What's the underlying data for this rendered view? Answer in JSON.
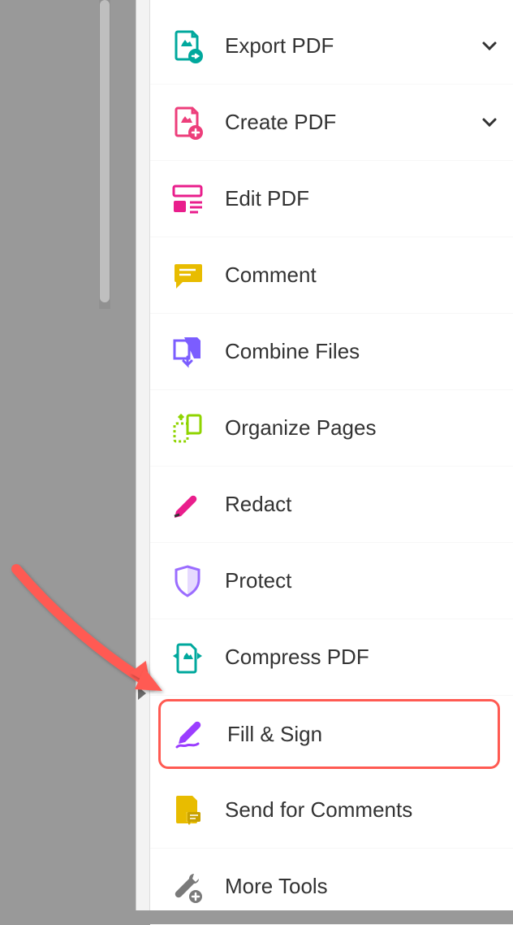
{
  "tools": [
    {
      "id": "export-pdf",
      "label": "Export PDF",
      "expandable": true,
      "icon": "export-pdf-icon",
      "color": "#00a89d"
    },
    {
      "id": "create-pdf",
      "label": "Create PDF",
      "expandable": true,
      "icon": "create-pdf-icon",
      "color": "#ed3e7b"
    },
    {
      "id": "edit-pdf",
      "label": "Edit PDF",
      "expandable": false,
      "icon": "edit-pdf-icon",
      "color": "#e91e8c"
    },
    {
      "id": "comment",
      "label": "Comment",
      "expandable": false,
      "icon": "comment-icon",
      "color": "#e8bc00"
    },
    {
      "id": "combine-files",
      "label": "Combine Files",
      "expandable": false,
      "icon": "combine-files-icon",
      "color": "#7b5dff"
    },
    {
      "id": "organize-pages",
      "label": "Organize Pages",
      "expandable": false,
      "icon": "organize-pages-icon",
      "color": "#8fd400"
    },
    {
      "id": "redact",
      "label": "Redact",
      "expandable": false,
      "icon": "redact-icon",
      "color": "#e91e8c"
    },
    {
      "id": "protect",
      "label": "Protect",
      "expandable": false,
      "icon": "protect-icon",
      "color": "#9b6dff"
    },
    {
      "id": "compress-pdf",
      "label": "Compress PDF",
      "expandable": false,
      "icon": "compress-pdf-icon",
      "color": "#00a89d"
    },
    {
      "id": "fill-and-sign",
      "label": "Fill & Sign",
      "expandable": false,
      "icon": "fill-sign-icon",
      "color": "#9b3dff",
      "highlighted": true
    },
    {
      "id": "send-for-comments",
      "label": "Send for Comments",
      "expandable": false,
      "icon": "send-comments-icon",
      "color": "#e8bc00"
    },
    {
      "id": "more-tools",
      "label": "More Tools",
      "expandable": false,
      "icon": "more-tools-icon",
      "color": "#7a7a7a"
    }
  ],
  "annotation": {
    "arrow_color": "#ff5a52",
    "highlight_color": "#ff5a52"
  }
}
